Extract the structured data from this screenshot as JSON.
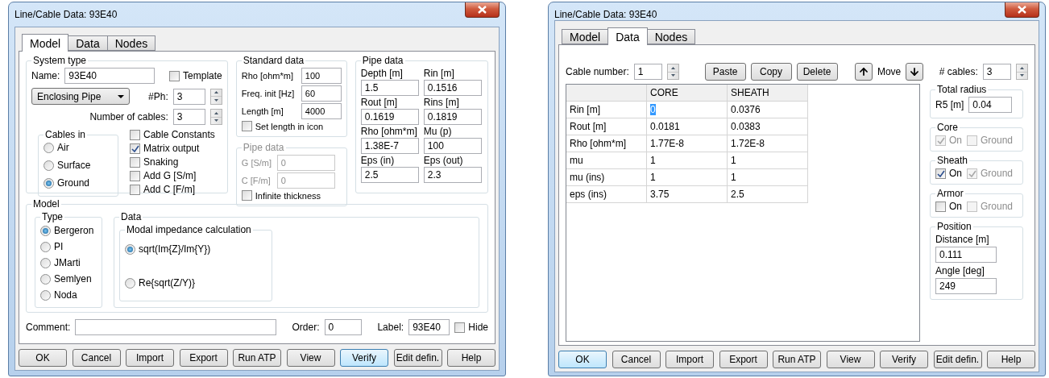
{
  "windows": [
    {
      "kind": "model",
      "title": "Line/Cable Data: 93E40",
      "tabs": [
        {
          "label": "Model",
          "selected": true
        },
        {
          "label": "Data",
          "selected": false
        },
        {
          "label": "Nodes",
          "selected": false
        }
      ],
      "system_type": {
        "legend": "System type",
        "name_label": "Name:",
        "name_value": "93E40",
        "template": {
          "label": "Template",
          "checked": false
        },
        "type_select": "Enclosing Pipe",
        "phases_label": "#Ph:",
        "phases_value": "3",
        "cables_label": "Number of cables:",
        "cables_value": "3",
        "cables_in": {
          "legend": "Cables in",
          "options": [
            {
              "label": "Air",
              "selected": false
            },
            {
              "label": "Surface",
              "selected": false
            },
            {
              "label": "Ground",
              "selected": true
            }
          ]
        },
        "options": [
          {
            "label": "Cable Constants",
            "checked": false
          },
          {
            "label": "Matrix output",
            "checked": true
          },
          {
            "label": "Snaking",
            "checked": false
          },
          {
            "label": "Add G [S/m]",
            "checked": false
          },
          {
            "label": "Add C [F/m]",
            "checked": false
          }
        ]
      },
      "standard_data": {
        "legend": "Standard data",
        "fields": [
          {
            "label": "Rho [ohm*m]",
            "value": "100"
          },
          {
            "label": "Freq. init [Hz]",
            "value": "60"
          },
          {
            "label": "Length [m]",
            "value": "4000"
          }
        ],
        "set_length": {
          "label": "Set length in icon",
          "checked": false
        }
      },
      "pipe_conductance": {
        "legend": "Pipe data",
        "disabled": true,
        "fields": [
          {
            "label": "G [S/m]",
            "value": "0"
          },
          {
            "label": "C [F/m]",
            "value": "0"
          }
        ],
        "infinite": {
          "label": "Infinite thickness",
          "checked": false
        }
      },
      "pipe_data": {
        "legend": "Pipe data",
        "fields": [
          {
            "label": "Depth [m]",
            "value": "1.5"
          },
          {
            "label": "Rin [m]",
            "value": "0.1516"
          },
          {
            "label": "Rout [m]",
            "value": "0.1619"
          },
          {
            "label": "Rins [m]",
            "value": "0.1819"
          },
          {
            "label": "Rho [ohm*m]",
            "value": "1.38E-7"
          },
          {
            "label": "Mu (p)",
            "value": "100"
          },
          {
            "label": "Eps (in)",
            "value": "2.5"
          },
          {
            "label": "Eps (out)",
            "value": "2.3"
          }
        ]
      },
      "model": {
        "legend": "Model",
        "type": {
          "legend": "Type",
          "options": [
            {
              "label": "Bergeron",
              "selected": true
            },
            {
              "label": "PI",
              "selected": false
            },
            {
              "label": "JMarti",
              "selected": false
            },
            {
              "label": "Semlyen",
              "selected": false
            },
            {
              "label": "Noda",
              "selected": false
            }
          ]
        },
        "data": {
          "legend": "Data",
          "modal": {
            "legend": "Modal impedance calculation",
            "options": [
              {
                "label": "sqrt(Im{Z}/Im{Y})",
                "selected": true
              },
              {
                "label": "Re{sqrt(Z/Y)}",
                "selected": false
              }
            ]
          }
        }
      },
      "footer": {
        "comment_label": "Comment:",
        "order_label": "Order:",
        "order_value": "0",
        "label_label": "Label:",
        "label_value": "93E40",
        "hide": {
          "label": "Hide",
          "checked": false
        }
      },
      "buttons": [
        {
          "label": "OK",
          "default": false
        },
        {
          "label": "Cancel",
          "default": false
        },
        {
          "label": "Import",
          "default": false
        },
        {
          "label": "Export",
          "default": false
        },
        {
          "label": "Run ATP",
          "default": false
        },
        {
          "label": "View",
          "default": false
        },
        {
          "label": "Verify",
          "default": true
        },
        {
          "label": "Edit defin.",
          "default": false
        },
        {
          "label": "Help",
          "default": false
        }
      ]
    },
    {
      "kind": "data",
      "title": "Line/Cable Data: 93E40",
      "tabs": [
        {
          "label": "Model",
          "selected": false
        },
        {
          "label": "Data",
          "selected": true
        },
        {
          "label": "Nodes",
          "selected": false
        }
      ],
      "cable_number": {
        "label": "Cable number:",
        "value": "1"
      },
      "edit_buttons": [
        {
          "label": "Paste"
        },
        {
          "label": "Copy"
        },
        {
          "label": "Delete"
        }
      ],
      "move": {
        "label": "Move"
      },
      "cables": {
        "label": "# cables:",
        "value": "3"
      },
      "table": {
        "columns": [
          "CORE",
          "SHEATH"
        ],
        "rows": [
          {
            "label": "Rin [m]",
            "cells": [
              {
                "text": "0",
                "selected": true
              },
              {
                "text": "0.0376",
                "selected": false
              }
            ]
          },
          {
            "label": "Rout [m]",
            "cells": [
              {
                "text": "0.0181",
                "selected": false
              },
              {
                "text": "0.0383",
                "selected": false
              }
            ]
          },
          {
            "label": "Rho [ohm*m]",
            "cells": [
              {
                "text": "1.77E-8",
                "selected": false
              },
              {
                "text": "1.72E-8",
                "selected": false
              }
            ]
          },
          {
            "label": "mu",
            "cells": [
              {
                "text": "1",
                "selected": false
              },
              {
                "text": "1",
                "selected": false
              }
            ]
          },
          {
            "label": "mu (ins)",
            "cells": [
              {
                "text": "1",
                "selected": false
              },
              {
                "text": "1",
                "selected": false
              }
            ]
          },
          {
            "label": "eps (ins)",
            "cells": [
              {
                "text": "3.75",
                "selected": false
              },
              {
                "text": "2.5",
                "selected": false
              }
            ]
          }
        ]
      },
      "total_radius": {
        "legend": "Total radius",
        "label": "R5 [m]",
        "value": "0.04"
      },
      "layers": [
        {
          "legend": "Core",
          "on": {
            "label": "On",
            "checked": true,
            "disabled": true
          },
          "ground": {
            "label": "Ground",
            "checked": false,
            "disabled": true
          }
        },
        {
          "legend": "Sheath",
          "on": {
            "label": "On",
            "checked": true,
            "disabled": false
          },
          "ground": {
            "label": "Ground",
            "checked": true,
            "disabled": true
          }
        },
        {
          "legend": "Armor",
          "on": {
            "label": "On",
            "checked": false,
            "disabled": false
          },
          "ground": {
            "label": "Ground",
            "checked": false,
            "disabled": true
          }
        }
      ],
      "position": {
        "legend": "Position",
        "fields": [
          {
            "label": "Distance [m]",
            "value": "0.111"
          },
          {
            "label": "Angle [deg]",
            "value": "249"
          }
        ]
      },
      "buttons": [
        {
          "label": "OK",
          "default": true
        },
        {
          "label": "Cancel",
          "default": false
        },
        {
          "label": "Import",
          "default": false
        },
        {
          "label": "Export",
          "default": false
        },
        {
          "label": "Run ATP",
          "default": false
        },
        {
          "label": "View",
          "default": false
        },
        {
          "label": "Verify",
          "default": false
        },
        {
          "label": "Edit defin.",
          "default": false
        },
        {
          "label": "Help",
          "default": false
        }
      ]
    }
  ]
}
